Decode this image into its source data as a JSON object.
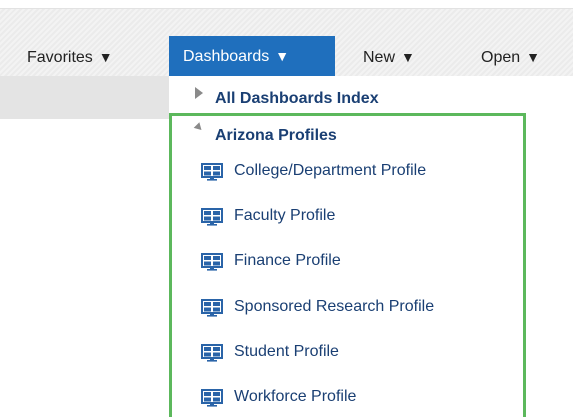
{
  "menubar": {
    "favorites": {
      "label": "Favorites",
      "caret": "▼"
    },
    "dashboards": {
      "label": "Dashboards",
      "caret": "▼",
      "active_color": "#1f6fbd"
    },
    "new": {
      "label": "New",
      "caret": "▼"
    },
    "open": {
      "label": "Open",
      "caret": "▼"
    }
  },
  "dropdown": {
    "all_index": {
      "label": "All Dashboards Index",
      "expanded": false
    },
    "group": {
      "label": "Arizona Profiles",
      "expanded": true,
      "highlight_color": "#5cb85c",
      "items": [
        {
          "label": "College/Department Profile",
          "icon": "dashboard-icon"
        },
        {
          "label": "Faculty Profile",
          "icon": "dashboard-icon"
        },
        {
          "label": "Finance Profile",
          "icon": "dashboard-icon"
        },
        {
          "label": "Sponsored Research Profile",
          "icon": "dashboard-icon"
        },
        {
          "label": "Student Profile",
          "icon": "dashboard-icon"
        },
        {
          "label": "Workforce Profile",
          "icon": "dashboard-icon"
        }
      ]
    }
  }
}
